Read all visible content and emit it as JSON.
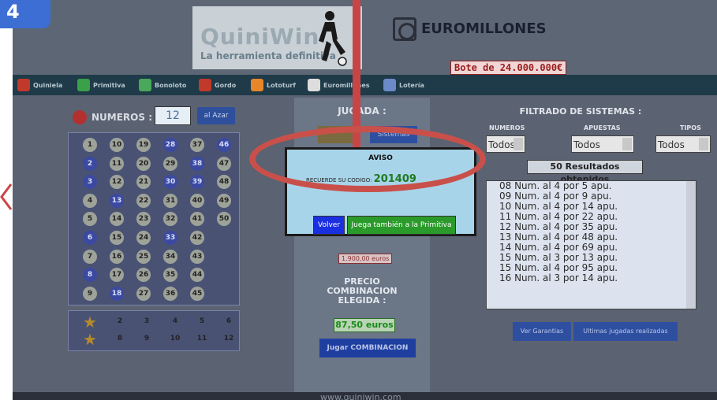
{
  "step": "4",
  "header": {
    "logo_title": "QuiniWin",
    "logo_subtitle": "La herramienta definitiva",
    "euromillones": "EUROMILLONES",
    "bote": "Bote de 24.000.000€"
  },
  "nav": {
    "items": [
      {
        "label": "Quiniela",
        "color": "#c0392b"
      },
      {
        "label": "Primitiva",
        "color": "#3aa04a"
      },
      {
        "label": "Bonoloto",
        "color": "#4aa85a"
      },
      {
        "label": "Gordo",
        "color": "#c0392b"
      },
      {
        "label": "Lototurf",
        "color": "#e8862a"
      },
      {
        "label": "Euromillones",
        "color": "#dddddd"
      },
      {
        "label": "Lotería",
        "color": "#6a8ac8"
      }
    ]
  },
  "numeros": {
    "label": "NUMEROS :",
    "value": "12",
    "azar_label": "al Azar"
  },
  "grid": {
    "columns": [
      [
        1,
        2,
        3,
        4,
        5,
        6,
        7,
        8,
        9
      ],
      [
        10,
        11,
        12,
        13,
        14,
        15,
        16,
        17,
        18
      ],
      [
        19,
        20,
        21,
        22,
        23,
        24,
        25,
        26,
        27
      ],
      [
        28,
        29,
        30,
        31,
        32,
        33,
        34,
        35,
        36
      ],
      [
        37,
        38,
        39,
        40,
        41,
        42,
        43,
        44,
        45
      ],
      [
        46,
        47,
        48,
        49,
        50
      ]
    ],
    "selected": [
      2,
      3,
      6,
      8,
      13,
      18,
      28,
      30,
      33,
      38,
      39,
      46
    ]
  },
  "stars": {
    "row1": [
      2,
      3,
      4,
      5,
      6
    ],
    "row2": [
      8,
      9,
      10,
      11,
      12
    ]
  },
  "middle": {
    "jugada_label": "JUGADA :",
    "sistemas_label": "Sistemas",
    "euro_small": "1.900,00 euros",
    "precio_line1": "PRECIO",
    "precio_line2": "COMBINACION",
    "precio_line3": "ELEGIDA :",
    "total": "87,50 euros",
    "jugar_label": "Jugar COMBINACION"
  },
  "filtrado": {
    "title": "FILTRADO DE SISTEMAS :",
    "col_numeros": "NUMEROS",
    "col_apuestas": "APUESTAS",
    "col_tipos": "TIPOS",
    "sel_numeros": "Todos",
    "sel_apuestas": "Todos",
    "sel_tipos": "Todos",
    "results": "50 Resultados obtenidos",
    "list": [
      "08 Num. al 4 por 5 apu.",
      "09 Num. al 4 por 9 apu.",
      "10 Num. al 4 por 14 apu.",
      "11 Num. al 4 por 22 apu.",
      "12 Num. al 4 por 35 apu.",
      "13 Num. al 4 por 48 apu.",
      "14 Num. al 4 por 69 apu.",
      "15 Num. al 3 por 13 apu.",
      "15 Num. al 4 por 95 apu.",
      "16 Num. al 3 por 14 apu."
    ],
    "garantias_label": "Ver Garantias",
    "ultimas_label": "Ultimas jugadas realizadas"
  },
  "modal": {
    "title": "AVISO",
    "code_prefix": "RECUERDE SU CODIGO:",
    "code": "201409",
    "volver_label": "Volver",
    "juega_label": "Juega también a la Primitiva"
  },
  "footer": {
    "url": "www.quiniwin.com"
  }
}
